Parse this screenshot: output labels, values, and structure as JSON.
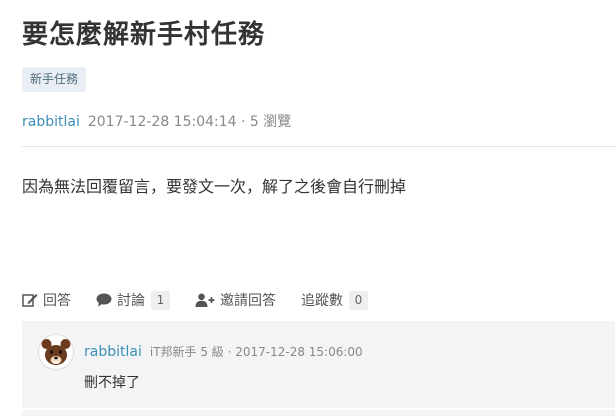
{
  "question": {
    "title": "要怎麼解新手村任務",
    "tag": "新手任務",
    "author": "rabbitlai",
    "datetime": "2017-12-28 15:04:14",
    "views": "· 5 瀏覽",
    "content": "因為無法回覆留言，要發文一次，解了之後會自行刪掉"
  },
  "actions": {
    "answer_label": "回答",
    "discuss_label": "討論",
    "discuss_count": "1",
    "invite_label": "邀請回答",
    "follow_label": "追蹤數",
    "follow_count": "0"
  },
  "comment": {
    "author": "rabbitlai",
    "rank": "iT邦新手 5 級 · 2017-12-28 15:06:00",
    "content": "刪不掉了"
  },
  "colors": {
    "link": "#3b8fb8",
    "tag_bg": "#e8eef3",
    "comment_bg": "#f3f4f6"
  },
  "icons": [
    "edit-icon",
    "comment-icon",
    "user-plus-icon",
    "bear-avatar"
  ]
}
